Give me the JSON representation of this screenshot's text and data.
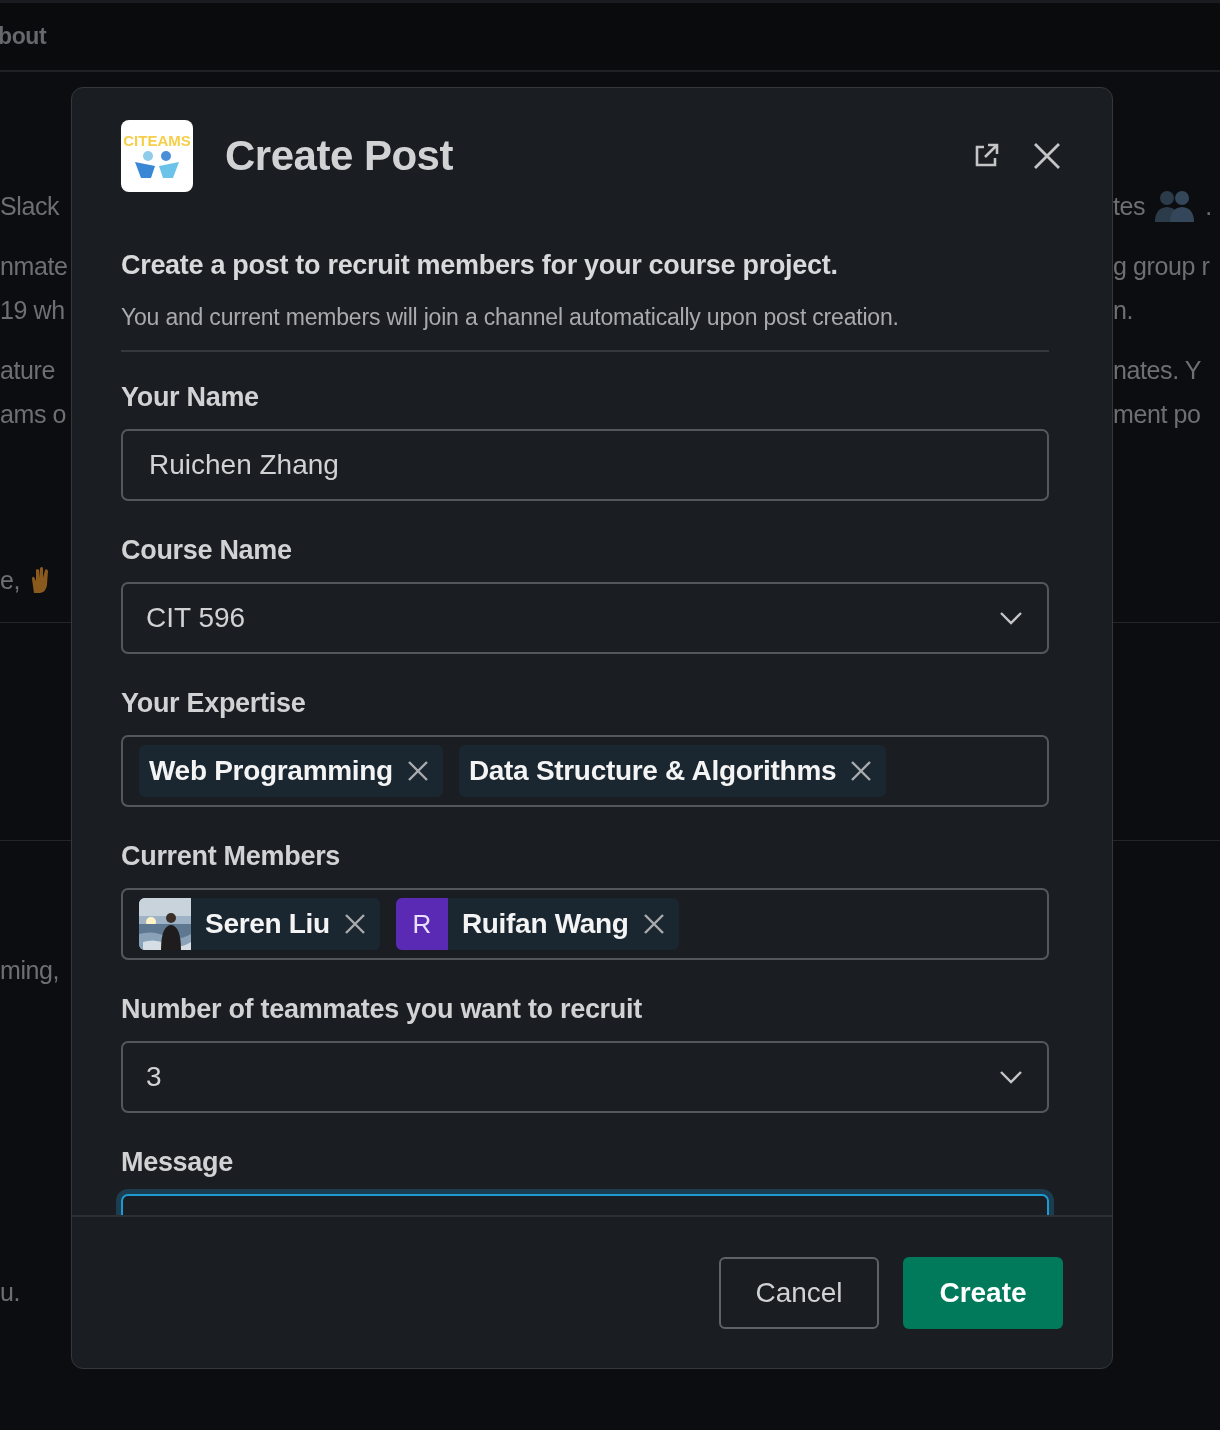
{
  "backdrop": {
    "header_text": "bout",
    "left_lines": [
      {
        "text": "Slack",
        "kind": "text"
      },
      {
        "text": "nmate",
        "kind": "text"
      },
      {
        "text": "19 wh",
        "kind": "text"
      },
      {
        "text": "ature",
        "kind": "text"
      },
      {
        "text": "ams o",
        "kind": "text"
      },
      {
        "text": "e,",
        "kind": "with_icon"
      },
      {
        "text": "ming,",
        "kind": "text"
      },
      {
        "text": "u.",
        "kind": "text"
      }
    ],
    "right_lines": [
      {
        "text": "tes",
        "kind": "with_icon",
        "suffix": "."
      },
      {
        "text": "g group r",
        "kind": "text"
      },
      {
        "text": "n.",
        "kind": "text"
      },
      {
        "text": "nates. Y",
        "kind": "text"
      },
      {
        "text": "ment po",
        "kind": "text"
      }
    ]
  },
  "modal": {
    "logo_text": "CITEAMS",
    "title": "Create Post",
    "intro": "Create a post to recruit members for your course project.",
    "description": "You and current members will join a channel automatically upon post creation.",
    "fields": [
      {
        "kind": "text",
        "label": "Your Name",
        "value": "Ruichen Zhang"
      },
      {
        "kind": "select",
        "label": "Course Name",
        "value": "CIT 596"
      },
      {
        "kind": "tags",
        "label": "Your Expertise",
        "tags": [
          "Web Programming",
          "Data Structure & Algorithms"
        ]
      },
      {
        "kind": "members",
        "label": "Current Members",
        "members": [
          {
            "name": "Seren Liu"
          },
          {
            "name": "Ruifan Wang",
            "kind": "initial",
            "initial": "R",
            "color": "#5b2ab5"
          }
        ]
      },
      {
        "kind": "select",
        "label": "Number of teammates you want to recruit",
        "value": "3"
      },
      {
        "kind": "textarea",
        "label": "Message",
        "focused": true
      }
    ],
    "buttons": [
      {
        "label": "Cancel",
        "kind": "secondary"
      },
      {
        "label": "Create",
        "kind": "primary"
      }
    ]
  }
}
